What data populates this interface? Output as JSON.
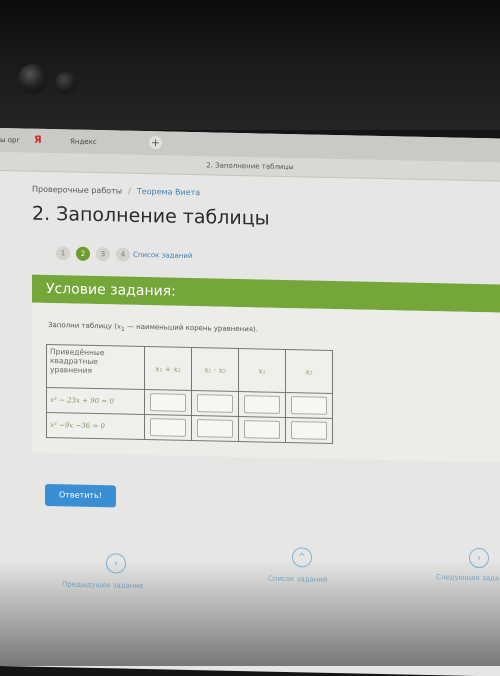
{
  "browser": {
    "tab_fragment": "ы орг",
    "yandex_icon": "Я",
    "yandex_tab": "Яндекс",
    "new_tab": "+",
    "window_title": "2. Заполнение таблицы"
  },
  "breadcrumb": {
    "first": "Проверочные работы",
    "separator": "/",
    "second": "Теорема Виета"
  },
  "page_title": "2. Заполнение таблицы",
  "pager": {
    "pages": [
      "1",
      "2",
      "3",
      "4"
    ],
    "active": "2",
    "list_label": "Список заданий"
  },
  "condition_header": "Условие задания:",
  "instruction": {
    "before": "Заполни таблицу (",
    "var": "x",
    "sub": "1",
    "after": " — наименьший корень уравнения)."
  },
  "table": {
    "header_first": "Приведённые квадратные уравнения",
    "headers": [
      "x₁ + x₂",
      "x₁ · x₂",
      "x₁",
      "x₂"
    ],
    "rows": [
      {
        "equation": "x² − 23x + 90 = 0"
      },
      {
        "equation": "x² −9x −36 = 0"
      }
    ]
  },
  "answer_button": "Ответить!",
  "nav": {
    "prev_icon": "‹",
    "prev_label": "Предыдущее задание",
    "list_icon": "^",
    "list_label": "Список заданий",
    "next_icon": "›",
    "next_label": "Следующее зада"
  },
  "colors": {
    "accent_green": "#74a63a",
    "button_blue": "#3a8fd4",
    "link_blue": "#3a7fb8"
  }
}
